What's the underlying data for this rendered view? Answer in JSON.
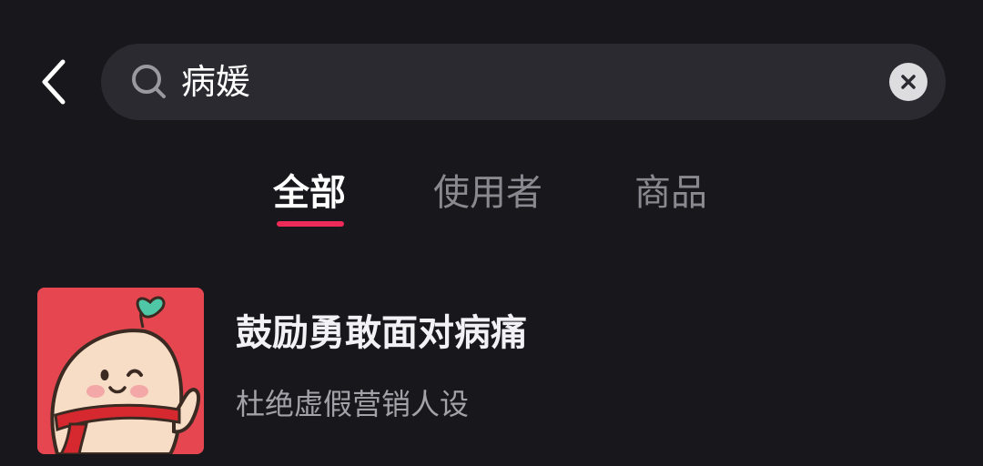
{
  "header": {
    "back_icon": "chevron-left-icon",
    "search": {
      "value": "病媛",
      "search_icon": "search-icon",
      "clear_icon": "clear-icon"
    }
  },
  "tabs": [
    {
      "label": "全部",
      "active": true
    },
    {
      "label": "使用者",
      "active": false
    },
    {
      "label": "商品",
      "active": false
    }
  ],
  "results": [
    {
      "title": "鼓励勇敢面对病痛",
      "subtitle": "杜绝虚假营销人设",
      "avatar_icon": "sprout-mascot-avatar"
    }
  ],
  "colors": {
    "background": "#18171c",
    "search_bg": "#2b2a31",
    "tab_active": "#ffffff",
    "tab_inactive": "#8a8990",
    "tab_indicator": "#ee2a59",
    "avatar_bg": "#e54650"
  }
}
